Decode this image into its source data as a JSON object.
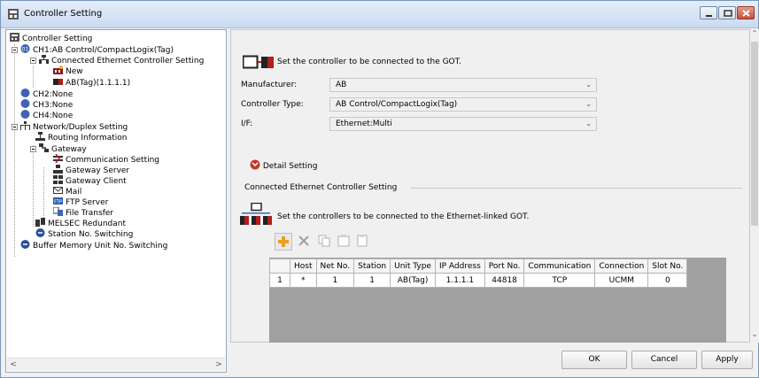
{
  "window": {
    "title": "Controller Setting"
  },
  "tree": {
    "items": [
      {
        "label": "Controller Setting"
      },
      {
        "label": "CH1:AB Control/CompactLogix(Tag)"
      },
      {
        "label": "Connected Ethernet Controller Setting"
      },
      {
        "label": "New"
      },
      {
        "label": "AB(Tag)(1.1.1.1)"
      },
      {
        "label": "CH2:None"
      },
      {
        "label": "CH3:None"
      },
      {
        "label": "CH4:None"
      },
      {
        "label": "Network/Duplex Setting"
      },
      {
        "label": "Routing Information"
      },
      {
        "label": "Gateway"
      },
      {
        "label": "Communication Setting"
      },
      {
        "label": "Gateway Server"
      },
      {
        "label": "Gateway Client"
      },
      {
        "label": "Mail"
      },
      {
        "label": "FTP Server"
      },
      {
        "label": "File Transfer"
      },
      {
        "label": "MELSEC Redundant"
      },
      {
        "label": "Station No. Switching"
      },
      {
        "label": "Buffer Memory Unit No. Switching"
      }
    ]
  },
  "main": {
    "intro": "Set the controller to be connected to the GOT.",
    "manufacturer_label": "Manufacturer:",
    "manufacturer_value": "AB",
    "type_label": "Controller Type:",
    "type_value": "AB Control/CompactLogix(Tag)",
    "if_label": "I/F:",
    "if_value": "Ethernet:Multi",
    "detail_setting": "Detail Setting",
    "section_title": "Connected Ethernet Controller Setting",
    "section_intro": "Set the controllers to be connected to the Ethernet-linked GOT."
  },
  "table": {
    "headers": [
      "",
      "Host",
      "Net No.",
      "Station",
      "Unit Type",
      "IP Address",
      "Port No.",
      "Communication",
      "Connection",
      "Slot No."
    ],
    "rows": [
      [
        "1",
        "*",
        "1",
        "1",
        "AB(Tag)",
        "1.1.1.1",
        "44818",
        "TCP",
        "UCMM",
        "0"
      ]
    ]
  },
  "buttons": {
    "ok": "OK",
    "cancel": "Cancel",
    "apply": "Apply"
  }
}
